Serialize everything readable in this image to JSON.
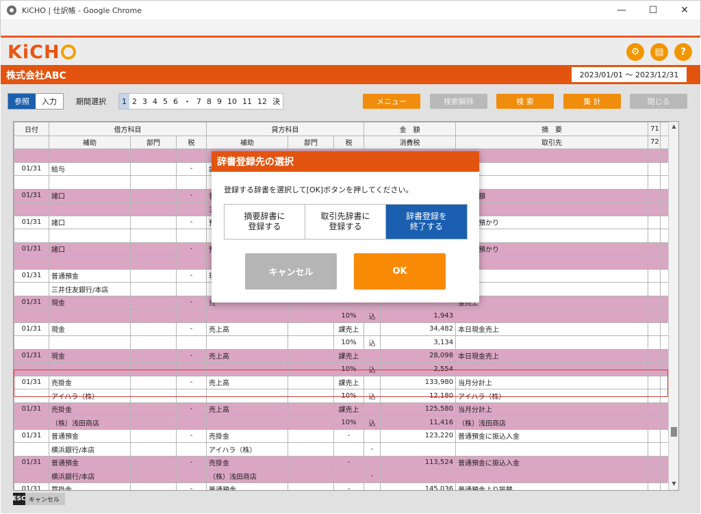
{
  "window": {
    "title": "KiCHO | 仕訳帳 - Google Chrome",
    "minimize": "—",
    "maximize": "☐",
    "close": "✕"
  },
  "app": {
    "logo": "KiCH",
    "company": "株式会社ABC",
    "period_range": "2023/01/01 ～ 2023/12/31",
    "header_icons": [
      "gear-icon",
      "print-icon",
      "help-icon"
    ]
  },
  "toolbar": {
    "mode_view": "参照",
    "mode_input": "入力",
    "period_label": "期間選択",
    "periods": [
      "1",
      "2",
      "3",
      "4",
      "5",
      "6",
      "・",
      "7",
      "8",
      "9",
      "10",
      "11",
      "12",
      "決"
    ],
    "menu": "メニュー",
    "clear_search": "検索解除",
    "search": "検 索",
    "aggregate": "集 計",
    "close": "閉じる"
  },
  "grid": {
    "header1": {
      "date": "日付",
      "debit": "借方科目",
      "credit": "貸方科目",
      "amount": "金　額",
      "memo": "摘　要",
      "c71": "71"
    },
    "header2": {
      "sub": "補助",
      "dept": "部門",
      "tax": "税",
      "sub2": "補助",
      "dept2": "部門",
      "tax2": "税",
      "consumption_tax": "消費税",
      "partner": "取引先",
      "c72": "72"
    },
    "rows": [
      {
        "cls": "pink",
        "cells": [
          "",
          "",
          "",
          "",
          "",
          "",
          "",
          "",
          "",
          "",
          "",
          ""
        ]
      },
      {
        "cls": "white",
        "cells": [
          "01/31",
          "給与",
          "",
          "-",
          "諸",
          "",
          "",
          "",
          "",
          "支給額",
          "",
          ""
        ]
      },
      {
        "cls": "white",
        "cells": [
          "",
          "",
          "",
          "",
          "",
          "",
          "",
          "",
          "",
          "",
          "",
          ""
        ]
      },
      {
        "cls": "pink",
        "cells": [
          "01/31",
          "諸口",
          "",
          "-",
          "普",
          "",
          "",
          "",
          "",
          "引支給額",
          "",
          ""
        ]
      },
      {
        "cls": "pink",
        "cells": [
          "",
          "",
          "",
          "",
          "三",
          "",
          "",
          "",
          "",
          "",
          "",
          ""
        ]
      },
      {
        "cls": "white",
        "cells": [
          "01/31",
          "諸口",
          "",
          "-",
          "預",
          "",
          "",
          "",
          "",
          "険料　預かり",
          "",
          ""
        ]
      },
      {
        "cls": "white",
        "cells": [
          "",
          "",
          "",
          "",
          "",
          "",
          "",
          "",
          "",
          "",
          "",
          ""
        ]
      },
      {
        "cls": "pink",
        "cells": [
          "01/31",
          "諸口",
          "",
          "-",
          "預",
          "",
          "",
          "",
          "",
          "得税　預かり",
          "",
          ""
        ]
      },
      {
        "cls": "pink",
        "cells": [
          "",
          "",
          "",
          "",
          "",
          "",
          "",
          "",
          "",
          "",
          "",
          ""
        ]
      },
      {
        "cls": "white",
        "cells": [
          "01/31",
          "普通預金",
          "",
          "-",
          "現",
          "",
          "",
          "",
          "",
          "れ",
          "",
          ""
        ]
      },
      {
        "cls": "white",
        "cells": [
          "",
          "三井住友銀行/本店",
          "",
          "",
          "",
          "",
          "",
          "",
          "",
          "",
          "",
          ""
        ]
      },
      {
        "cls": "pink",
        "cells": [
          "01/31",
          "現金",
          "",
          "-",
          "売",
          "",
          "",
          "",
          "",
          "金売上",
          "",
          ""
        ]
      },
      {
        "cls": "pink",
        "cells": [
          "",
          "",
          "",
          "",
          "",
          "",
          "10%",
          "込",
          "1,943",
          "",
          "",
          ""
        ]
      },
      {
        "cls": "white",
        "cells": [
          "01/31",
          "現金",
          "",
          "-",
          "売上高",
          "",
          "課売上",
          "",
          "34,482",
          "本日現金売上",
          "",
          ""
        ]
      },
      {
        "cls": "white",
        "cells": [
          "",
          "",
          "",
          "",
          "",
          "",
          "10%",
          "込",
          "3,134",
          "",
          "",
          ""
        ]
      },
      {
        "cls": "pink",
        "cells": [
          "01/31",
          "現金",
          "",
          "-",
          "売上高",
          "",
          "課売上",
          "",
          "28,098",
          "本日現金売上",
          "",
          ""
        ]
      },
      {
        "cls": "pink",
        "cells": [
          "",
          "",
          "",
          "",
          "",
          "",
          "10%",
          "込",
          "2,554",
          "",
          "",
          ""
        ]
      },
      {
        "cls": "white",
        "cells": [
          "01/31",
          "売掛金",
          "",
          "-",
          "売上高",
          "",
          "課売上",
          "",
          "133,980",
          "当月分計上",
          "",
          ""
        ]
      },
      {
        "cls": "white",
        "cells": [
          "",
          "アイハラ（株）",
          "",
          "",
          "",
          "",
          "10%",
          "込",
          "12,180",
          "アイハラ（株）",
          "",
          ""
        ]
      },
      {
        "cls": "pink",
        "cells": [
          "01/31",
          "売掛金",
          "",
          "-",
          "売上高",
          "",
          "課売上",
          "",
          "125,580",
          "当月分計上",
          "",
          ""
        ]
      },
      {
        "cls": "pink",
        "cells": [
          "",
          "（株）浅田商店",
          "",
          "",
          "",
          "",
          "10%",
          "込",
          "11,416",
          "（株）浅田商店",
          "",
          ""
        ]
      },
      {
        "cls": "white",
        "cells": [
          "01/31",
          "普通預金",
          "",
          "-",
          "売掛金",
          "",
          "-",
          "",
          "123,220",
          "普通預金に振込入金",
          "",
          ""
        ]
      },
      {
        "cls": "white",
        "cells": [
          "",
          "横浜銀行/本店",
          "",
          "",
          "アイハラ（株）",
          "",
          "",
          "-",
          "",
          "",
          "",
          ""
        ]
      },
      {
        "cls": "pink",
        "cells": [
          "01/31",
          "普通預金",
          "",
          "-",
          "売掛金",
          "",
          "-",
          "",
          "113,524",
          "普通預金に振込入金",
          "",
          ""
        ]
      },
      {
        "cls": "pink",
        "cells": [
          "",
          "横浜銀行/本店",
          "",
          "",
          "（株）浅田商店",
          "",
          "",
          "-",
          "",
          "",
          "",
          ""
        ]
      },
      {
        "cls": "white",
        "cells": [
          "01/31",
          "買掛金",
          "",
          "-",
          "普通預金",
          "",
          "-",
          "",
          "145,036",
          "普通預金より振替",
          "",
          ""
        ]
      }
    ]
  },
  "footer": {
    "esc": "ESC",
    "label": "キャンセル"
  },
  "modal": {
    "title": "辞書登録先の選択",
    "message": "登録する辞書を選択して[OK]ボタンを押してください。",
    "choices": [
      "摘要辞書に\n登録する",
      "取引先辞書に\n登録する",
      "辞書登録を\n終了する"
    ],
    "cancel": "キャンセル",
    "ok": "OK"
  }
}
